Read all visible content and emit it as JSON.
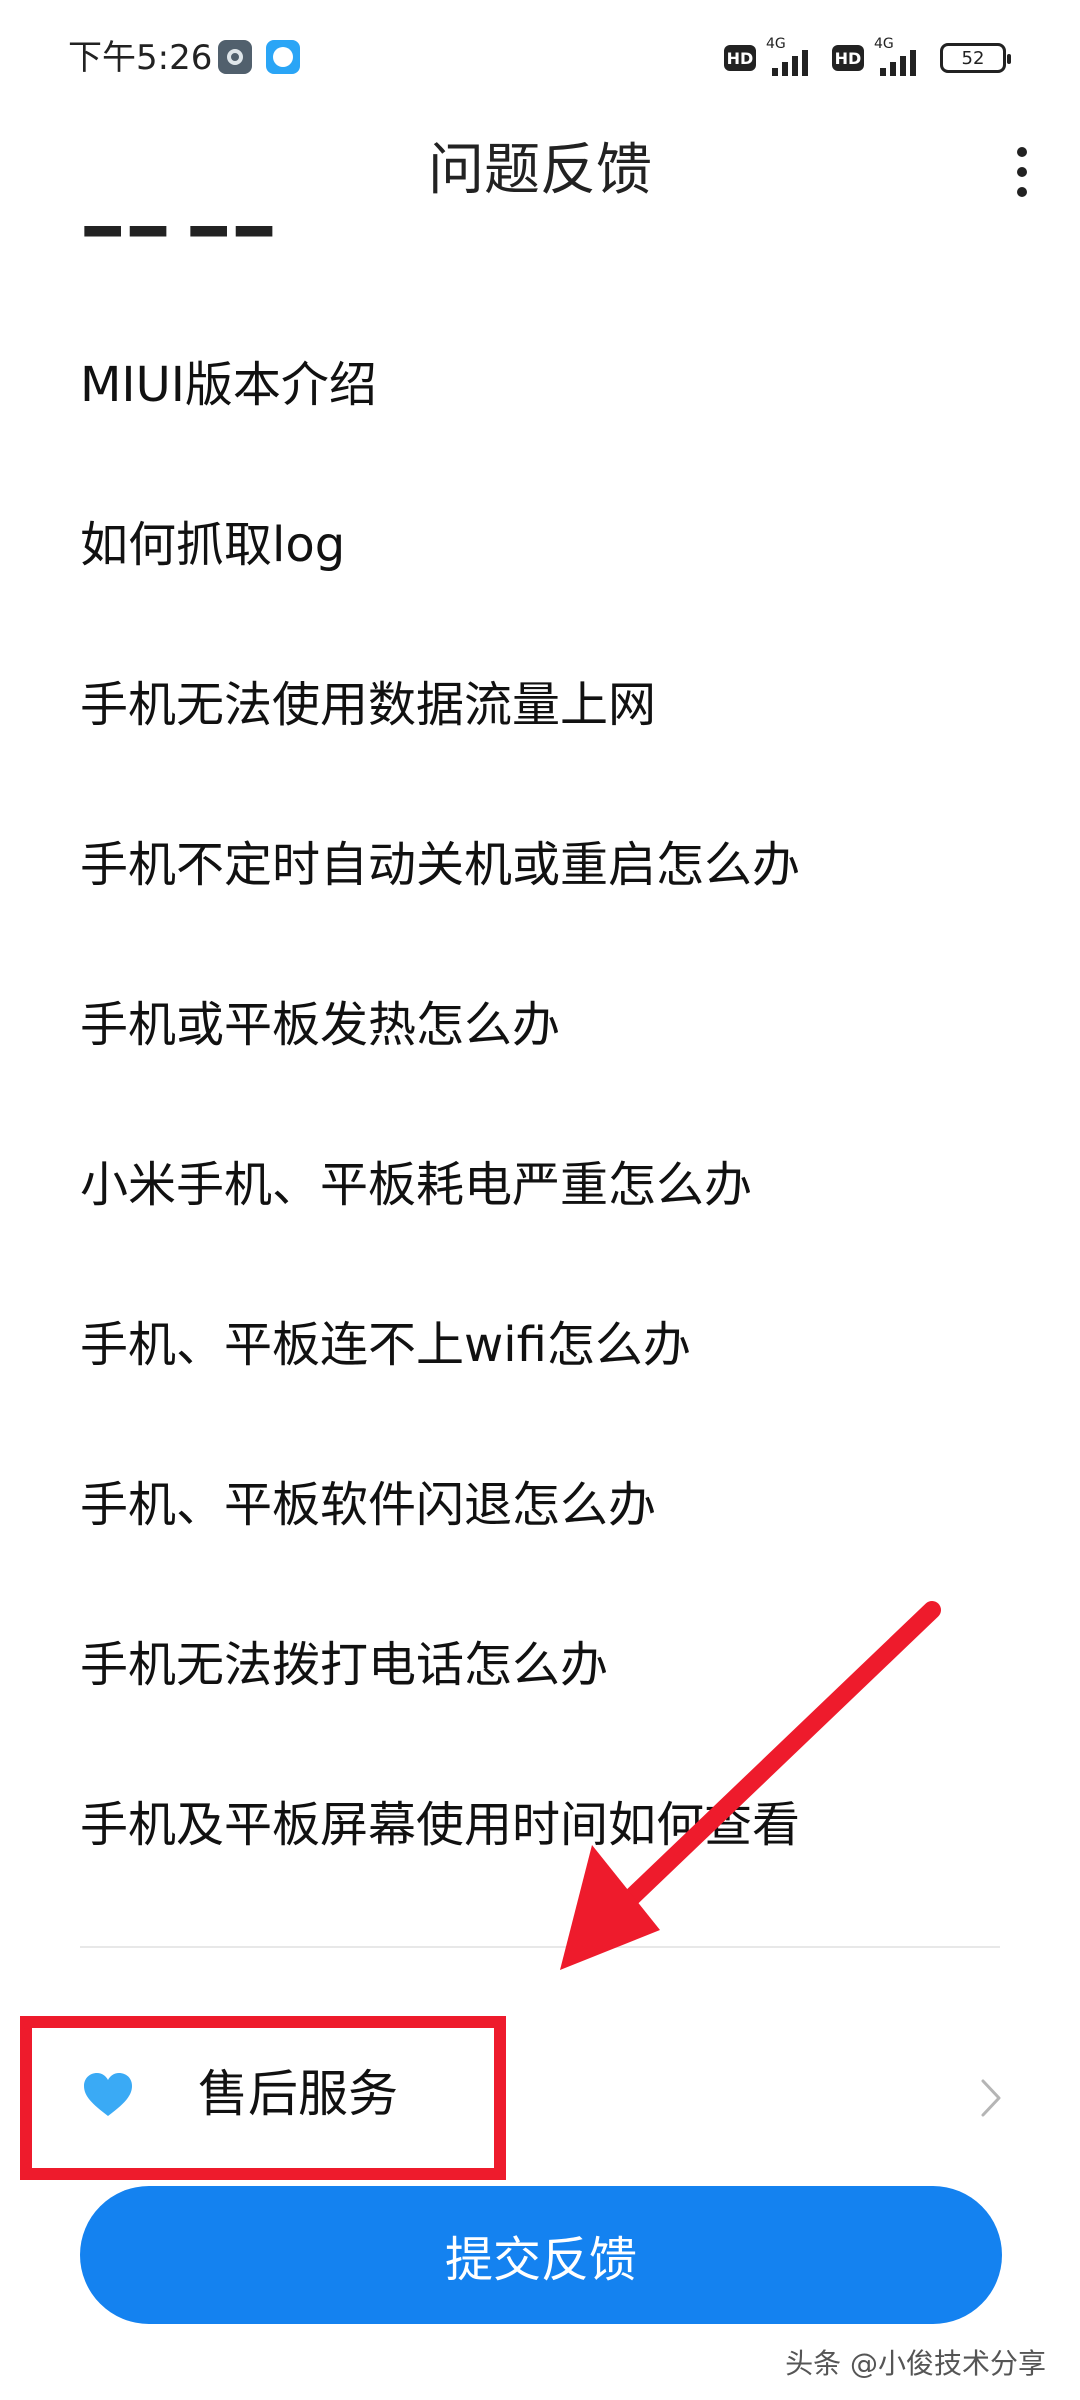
{
  "status_bar": {
    "time": "下午5:26",
    "hd_label": "HD",
    "network_type": "4G",
    "battery": "52"
  },
  "header": {
    "title": "问题反馈"
  },
  "faq": {
    "items": [
      "MIUI版本介绍",
      "如何抓取log",
      "手机无法使用数据流量上网",
      "手机不定时自动关机或重启怎么办",
      "手机或平板发热怎么办",
      "小米手机、平板耗电严重怎么办",
      "手机、平板连不上wifi怎么办",
      "手机、平板软件闪退怎么办",
      "手机无法拨打电话怎么办",
      "手机及平板屏幕使用时间如何查看"
    ]
  },
  "service": {
    "label": "售后服务",
    "icon": "heart-icon"
  },
  "submit": {
    "label": "提交反馈"
  },
  "watermark": "头条 @小俊技术分享",
  "colors": {
    "accent": "#1482f0",
    "annotation_red": "#ee1b2c",
    "heart": "#3aaaf5"
  }
}
